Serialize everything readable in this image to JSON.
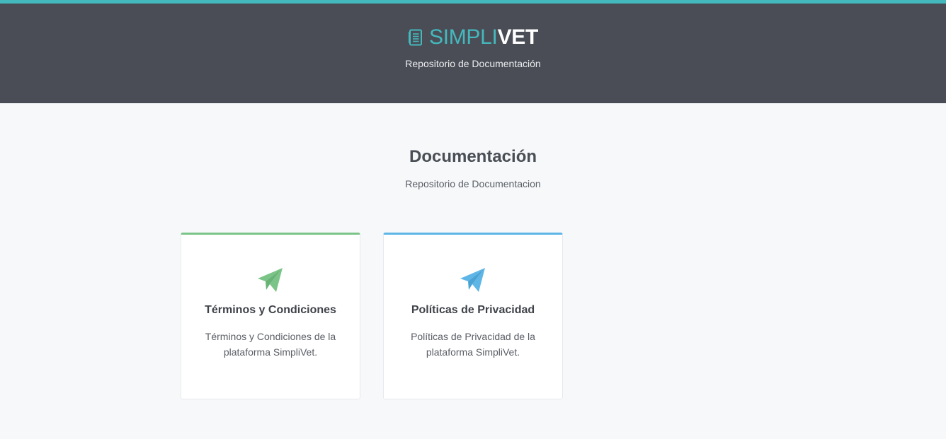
{
  "header": {
    "brand_part1": "SIMPLI",
    "brand_part2": "VET",
    "subtitle": "Repositorio de Documentación",
    "logo_icon": "document-icon"
  },
  "main": {
    "title": "Documentación",
    "subtitle": "Repositorio de Documentacion",
    "cards": [
      {
        "title": "Términos y Condiciones",
        "description": "Términos y Condiciones de la plataforma SimpliVet.",
        "icon": "paper-plane-icon",
        "accent": "#7bc488"
      },
      {
        "title": "Políticas de Privacidad",
        "description": "Políticas de Privacidad de la plataforma SimpliVet.",
        "icon": "paper-plane-icon",
        "accent": "#5eb6e6"
      }
    ]
  },
  "colors": {
    "top_line": "#44b9bd",
    "header_bg": "#4a4d56",
    "page_bg": "#f7f8fa"
  }
}
